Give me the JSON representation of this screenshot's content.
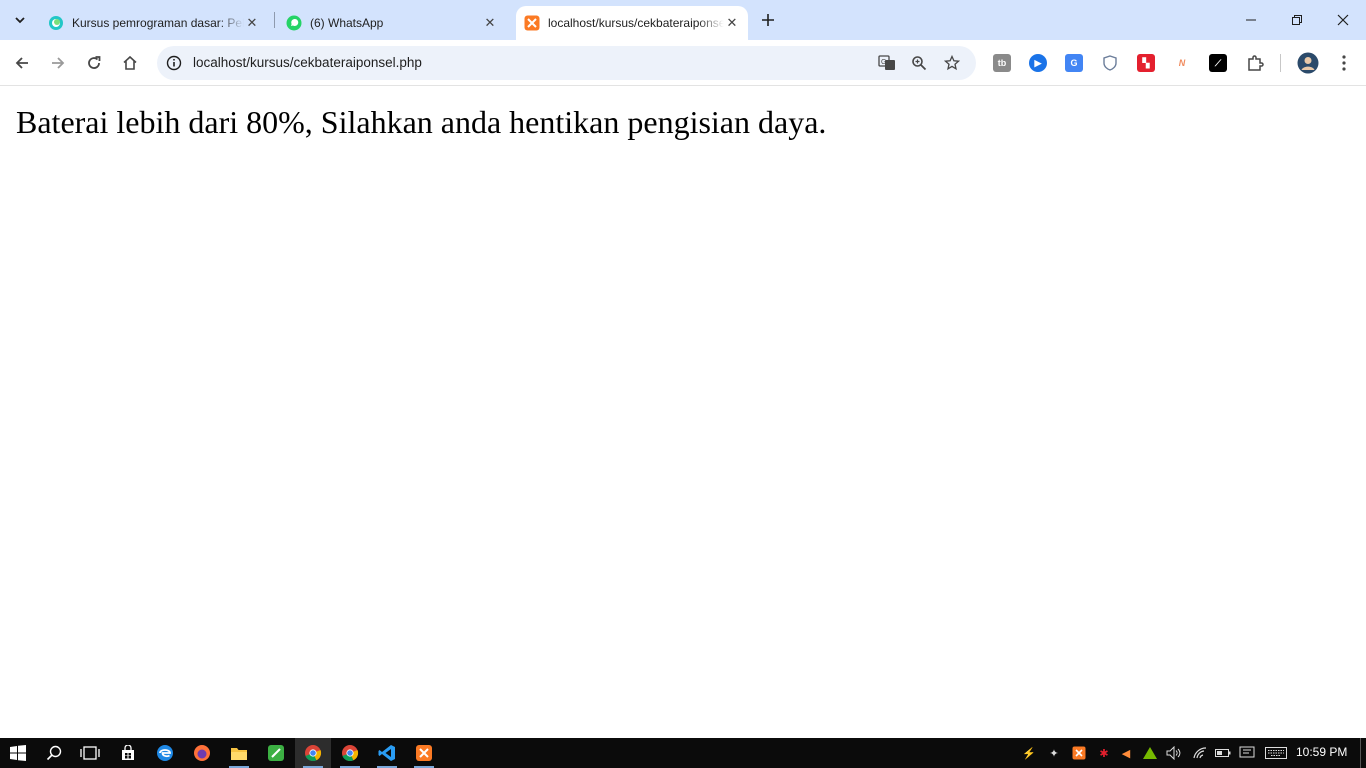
{
  "browser": {
    "tabs": [
      {
        "title": "Kursus pemrograman dasar: Pel",
        "favicon": "circle-logo-icon"
      },
      {
        "title": "(6) WhatsApp",
        "favicon": "whatsapp-icon"
      },
      {
        "title": "localhost/kursus/cekbateraiponsel.php",
        "favicon": "xampp-icon",
        "active": true
      }
    ],
    "url": "localhost/kursus/cekbateraiponsel.php"
  },
  "page": {
    "message": "Baterai lebih dari 80%, Silahkan anda hentikan pengisian daya."
  },
  "taskbar": {
    "clock": "10:59 PM"
  },
  "colors": {
    "tabstrip": "#d3e3fd",
    "omnibox": "#edf2fa",
    "taskbar": "#0b0b0b"
  }
}
